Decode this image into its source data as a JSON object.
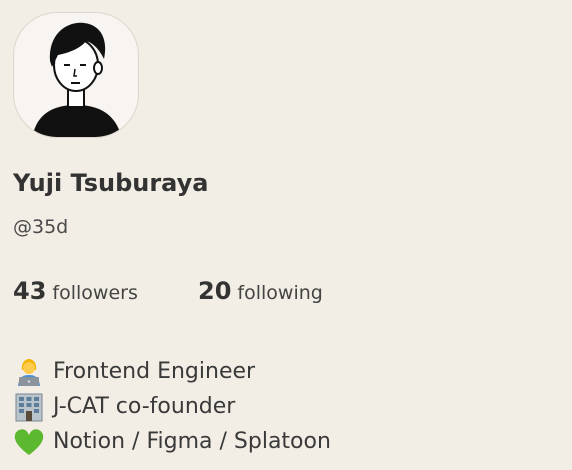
{
  "profile": {
    "name": "Yuji Tsuburaya",
    "handle": "@35d",
    "avatar_icon": "avatar-illustration"
  },
  "stats": {
    "followers_count": "43",
    "followers_label": "followers",
    "following_count": "20",
    "following_label": "following"
  },
  "bio": [
    {
      "icon": "person-with-laptop-icon",
      "text": "Frontend Engineer"
    },
    {
      "icon": "office-building-icon",
      "text": "J-CAT co-founder"
    },
    {
      "icon": "green-heart-icon",
      "text": "Notion / Figma / Splatoon"
    }
  ],
  "colors": {
    "background": "#f2eee5",
    "text": "#333333",
    "heart": "#5cb82e"
  }
}
